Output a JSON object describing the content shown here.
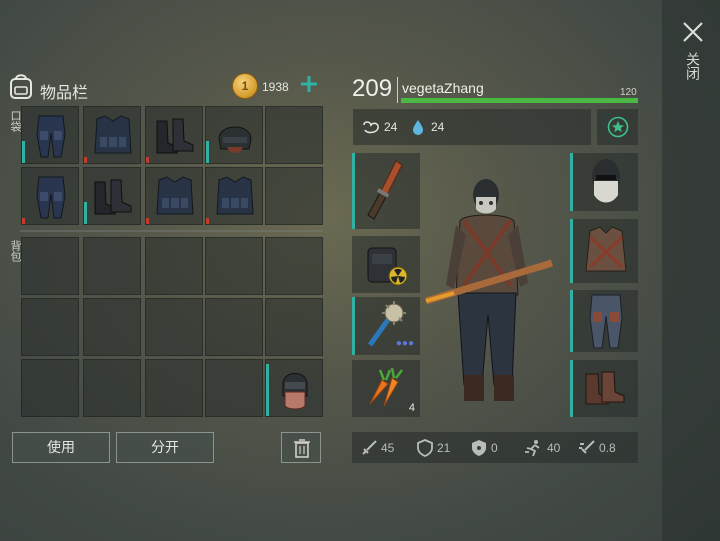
{
  "close": {
    "label": "关闭"
  },
  "inventory": {
    "title": "物品栏",
    "coins": "1938",
    "pockets_label": "口袋",
    "backpack_label": "背包",
    "use_button": "使用",
    "split_button": "分开"
  },
  "character": {
    "level": "209",
    "name": "vegetaZhang",
    "hp_max": "120",
    "food": "24",
    "water": "24",
    "carrot_count": "4"
  },
  "stats": {
    "attack": "45",
    "defense": "21",
    "radiation": "0",
    "speed": "40",
    "attack_speed": "0.8"
  },
  "colors": {
    "teal": "#2fb1a3",
    "hp": "#4ab843",
    "durability_low": "#c23b2d"
  }
}
